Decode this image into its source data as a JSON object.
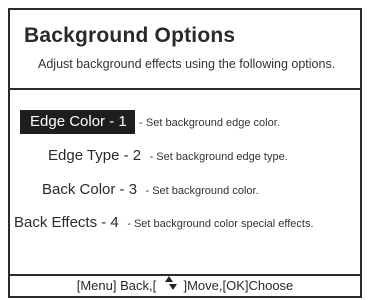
{
  "dialog": {
    "title": "Background Options",
    "subtitle": "Adjust background effects using the following options."
  },
  "menu": {
    "items": [
      {
        "label": "Edge Color - 1",
        "desc": "- Set background edge color.",
        "selected": true
      },
      {
        "label": "Edge Type - 2",
        "desc": "- Set background edge type.",
        "selected": false
      },
      {
        "label": "Back Color - 3",
        "desc": "- Set background color.",
        "selected": false
      },
      {
        "label": "Back Effects - 4",
        "desc": "- Set background color special effects.",
        "selected": false
      }
    ]
  },
  "footer": {
    "back_text": "[Menu] Back,[",
    "move_text": "]Move,[OK]Choose",
    "icons": [
      "up-arrow-icon",
      "down-arrow-icon"
    ]
  }
}
